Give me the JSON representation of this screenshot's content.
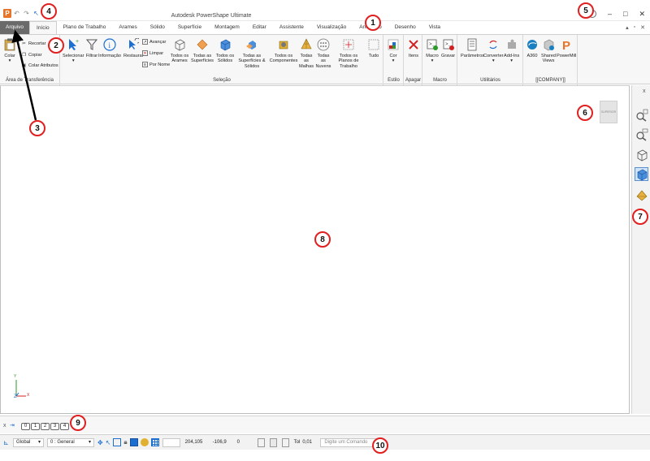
{
  "window": {
    "title": "Autodesk PowerShape Ultimate",
    "logo_letter": "P",
    "help_icon": "?",
    "minimize": "–",
    "maximize": "□",
    "close": "✕"
  },
  "qat": {
    "undo": "↶",
    "redo": "↷",
    "select": "↖",
    "more": "▾"
  },
  "tabs": [
    {
      "label": "Arquivo"
    },
    {
      "label": "Início"
    },
    {
      "label": "Plano de Trabalho"
    },
    {
      "label": "Arames"
    },
    {
      "label": "Sólido"
    },
    {
      "label": "Superfície"
    },
    {
      "label": "Montagem"
    },
    {
      "label": "Editar"
    },
    {
      "label": "Assistente"
    },
    {
      "label": "Visualização"
    },
    {
      "label": "Anotação"
    },
    {
      "label": "Desenho"
    },
    {
      "label": "Vista"
    }
  ],
  "tab_right": {
    "collapse": "▴",
    "restore": "▫",
    "close": "✕"
  },
  "ribbon": {
    "clipboard": {
      "colar": "Colar",
      "recortar": "Recortar",
      "copiar": "Copiar",
      "colar_atributos": "Colar Atributos",
      "group": "Área de Transferência"
    },
    "selecao": {
      "selecionar": "Selecionar",
      "filtrar": "Filtrar",
      "informacao": "Informação",
      "restaurar": "Restaurar",
      "avancar": "Avançar",
      "limpar": "Limpar",
      "por_nome": "Por Nome",
      "todos_arames": "Todos os Arames",
      "todas_superficies": "Todas as Superfícies",
      "todos_solidos": "Todos os Sólidos",
      "todas_superficies_solidos": "Todas as Superfícies & Sólidos",
      "todos_componentes": "Todos os Componentes",
      "todas_malhas": "Todas as Malhas",
      "todas_nuvens": "Todas as Nuvens",
      "todos_planos": "Todos os Planos de Trabalho",
      "tudo": "Tudo",
      "group": "Seleção"
    },
    "estilo": {
      "cor": "Cor",
      "group": "Estilo"
    },
    "apagar": {
      "itens": "Itens",
      "group": "Apagar"
    },
    "macro": {
      "macro": "Macro",
      "gravar": "Gravar",
      "group": "Macro"
    },
    "utilitarios": {
      "parametros": "Parâmetros",
      "converter": "Converter",
      "addins": "Add-Ins",
      "group": "Utilitários"
    },
    "company": {
      "a360": "A360",
      "shared_views": "Shared Views",
      "powermill": "PowerMill",
      "group": "[[COMPANY]]"
    }
  },
  "canvas": {
    "view_cube_label": "SUPERIOR",
    "axis_x": "X",
    "axis_y": "Y",
    "axis_z": "Z"
  },
  "right_toolbar_close": "x",
  "bottom_tabs": [
    "0",
    "1",
    "2",
    "3",
    "4"
  ],
  "status": {
    "workplane": "Global",
    "level": "0  : General",
    "coord_x": "204,105",
    "coord_y": "-106,9",
    "coord_z": "0",
    "tol_label": "Tol",
    "tol_value": "0,01",
    "command_placeholder": "Digite um Comando"
  },
  "callouts": [
    "1",
    "2",
    "3",
    "4",
    "5",
    "6",
    "7",
    "8",
    "9",
    "10"
  ]
}
